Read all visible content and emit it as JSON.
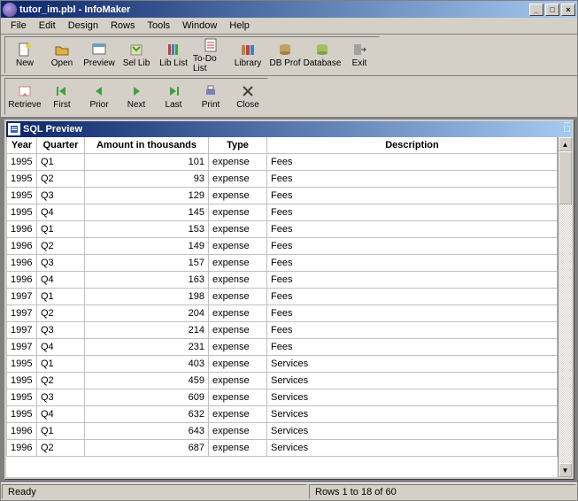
{
  "window": {
    "title": "tutor_im.pbl - InfoMaker"
  },
  "menubar": {
    "items": [
      "File",
      "Edit",
      "Design",
      "Rows",
      "Tools",
      "Window",
      "Help"
    ]
  },
  "toolbar1": {
    "items": [
      {
        "label": "New",
        "icon": "new"
      },
      {
        "label": "Open",
        "icon": "open"
      },
      {
        "label": "Preview",
        "icon": "preview"
      },
      {
        "label": "Sel Lib",
        "icon": "sellib"
      },
      {
        "label": "Lib List",
        "icon": "liblist"
      },
      {
        "label": "To-Do List",
        "icon": "todo"
      },
      {
        "label": "Library",
        "icon": "library"
      },
      {
        "label": "DB Prof",
        "icon": "dbprof"
      },
      {
        "label": "Database",
        "icon": "database"
      },
      {
        "label": "Exit",
        "icon": "exit"
      }
    ]
  },
  "toolbar2": {
    "items": [
      {
        "label": "Retrieve",
        "icon": "retrieve"
      },
      {
        "label": "First",
        "icon": "first"
      },
      {
        "label": "Prior",
        "icon": "prior"
      },
      {
        "label": "Next",
        "icon": "next"
      },
      {
        "label": "Last",
        "icon": "last"
      },
      {
        "label": "Print",
        "icon": "print"
      },
      {
        "label": "Close",
        "icon": "close"
      }
    ]
  },
  "child": {
    "title": "SQL Preview"
  },
  "grid": {
    "columns": [
      "Year",
      "Quarter",
      "Amount in thousands",
      "Type",
      "Description"
    ],
    "rows": [
      {
        "year": "1995",
        "quarter": "Q1",
        "amount": "101",
        "type": "expense",
        "desc": "Fees"
      },
      {
        "year": "1995",
        "quarter": "Q2",
        "amount": "93",
        "type": "expense",
        "desc": "Fees"
      },
      {
        "year": "1995",
        "quarter": "Q3",
        "amount": "129",
        "type": "expense",
        "desc": "Fees"
      },
      {
        "year": "1995",
        "quarter": "Q4",
        "amount": "145",
        "type": "expense",
        "desc": "Fees"
      },
      {
        "year": "1996",
        "quarter": "Q1",
        "amount": "153",
        "type": "expense",
        "desc": "Fees"
      },
      {
        "year": "1996",
        "quarter": "Q2",
        "amount": "149",
        "type": "expense",
        "desc": "Fees"
      },
      {
        "year": "1996",
        "quarter": "Q3",
        "amount": "157",
        "type": "expense",
        "desc": "Fees"
      },
      {
        "year": "1996",
        "quarter": "Q4",
        "amount": "163",
        "type": "expense",
        "desc": "Fees"
      },
      {
        "year": "1997",
        "quarter": "Q1",
        "amount": "198",
        "type": "expense",
        "desc": "Fees"
      },
      {
        "year": "1997",
        "quarter": "Q2",
        "amount": "204",
        "type": "expense",
        "desc": "Fees"
      },
      {
        "year": "1997",
        "quarter": "Q3",
        "amount": "214",
        "type": "expense",
        "desc": "Fees"
      },
      {
        "year": "1997",
        "quarter": "Q4",
        "amount": "231",
        "type": "expense",
        "desc": "Fees"
      },
      {
        "year": "1995",
        "quarter": "Q1",
        "amount": "403",
        "type": "expense",
        "desc": "Services"
      },
      {
        "year": "1995",
        "quarter": "Q2",
        "amount": "459",
        "type": "expense",
        "desc": "Services"
      },
      {
        "year": "1995",
        "quarter": "Q3",
        "amount": "609",
        "type": "expense",
        "desc": "Services"
      },
      {
        "year": "1995",
        "quarter": "Q4",
        "amount": "632",
        "type": "expense",
        "desc": "Services"
      },
      {
        "year": "1996",
        "quarter": "Q1",
        "amount": "643",
        "type": "expense",
        "desc": "Services"
      },
      {
        "year": "1996",
        "quarter": "Q2",
        "amount": "687",
        "type": "expense",
        "desc": "Services"
      }
    ]
  },
  "status": {
    "ready": "Ready",
    "rows": "Rows 1 to 18 of 60"
  },
  "icons": {
    "colors": {
      "new": "#e0d040",
      "open": "#e0b040",
      "preview": "#60a0d0",
      "retrieve": "#d08080",
      "nav": "#40a040",
      "print": "#8080c0",
      "db": "#c0a060",
      "exit": "#808080"
    }
  }
}
